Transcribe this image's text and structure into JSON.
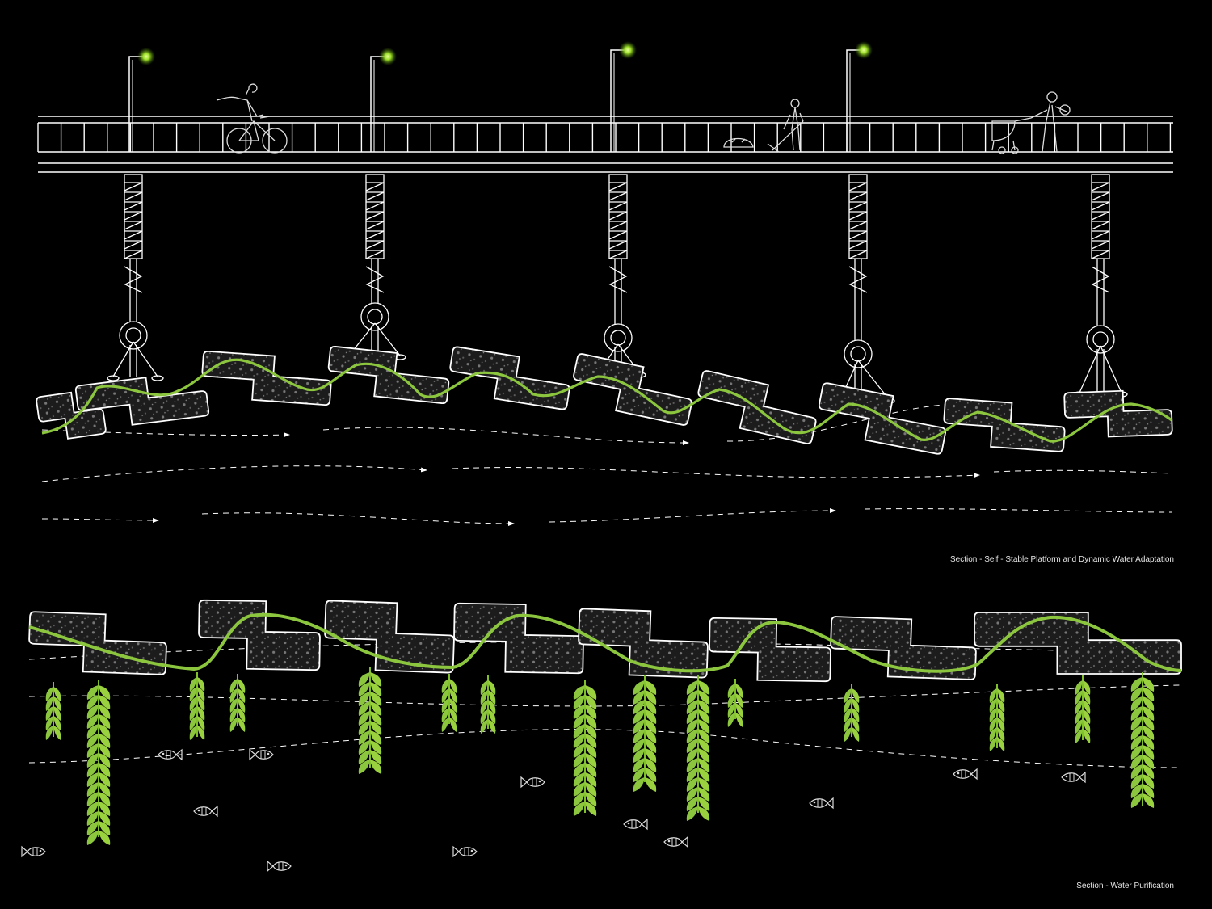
{
  "captions": {
    "section_1": "Section - Self - Stable Platform and Dynamic Water Adaptation",
    "section_2": "Section - Water Purification"
  },
  "colors": {
    "background": "#000000",
    "line": "#ffffff",
    "accent_green": "#8cc63f",
    "lamp_glow": "#b5f23a",
    "module_fill": "#1c1c1c",
    "dot": "#6a6a6a",
    "plant": "#7fbf2a"
  },
  "icons": {
    "lamp": "street-lamp-icon",
    "cyclist": "cyclist-icon",
    "sweeper": "street-sweeper-icon",
    "stroller": "stroller-parent-icon",
    "fish": "fish-icon",
    "plant": "aquatic-plant-icon",
    "flow": "water-flow-arrow-icon"
  }
}
